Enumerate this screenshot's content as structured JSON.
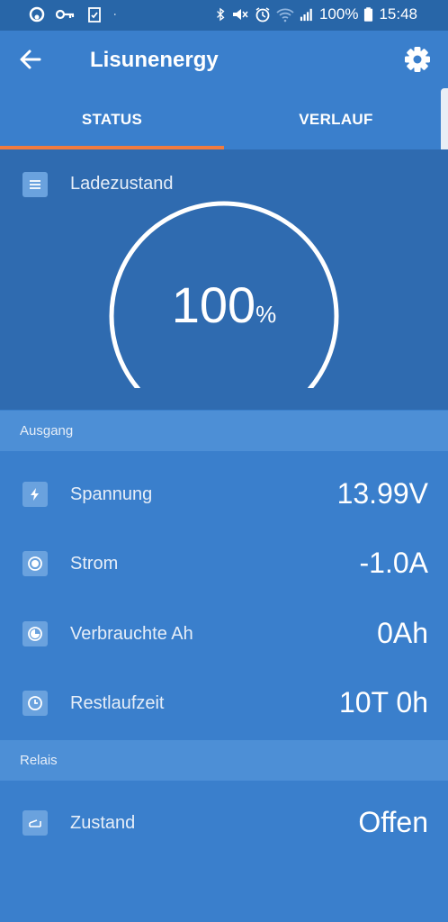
{
  "status_bar": {
    "battery": "100%",
    "time": "15:48",
    "icons": [
      "app-icon",
      "key-icon",
      "clipboard-check-icon",
      "dot-icon",
      "bluetooth-icon",
      "mute-icon",
      "alarm-icon",
      "wifi-icon",
      "signal-icon",
      "battery-icon"
    ]
  },
  "app_bar": {
    "title": "Lisunenergy",
    "back_icon": "arrow-back-icon",
    "settings_icon": "gear-icon"
  },
  "tabs": [
    {
      "label": "STATUS",
      "active": true
    },
    {
      "label": "VERLAUF",
      "active": false
    }
  ],
  "colors": {
    "accent": "#f07b3f",
    "primary": "#3a7fcc",
    "dark_card": "#2f6bb0",
    "section": "#4d8fd6"
  },
  "gauge": {
    "label": "Ladezustand",
    "value": "100",
    "unit": "%",
    "fraction": 1.0,
    "icon": "battery-list-icon"
  },
  "sections": {
    "output": {
      "title": "Ausgang",
      "rows": [
        {
          "label": "Spannung",
          "value": "13.99V",
          "icon": "bolt-icon"
        },
        {
          "label": "Strom",
          "value": "-1.0A",
          "icon": "circle-dot-icon"
        },
        {
          "label": "Verbrauchte Ah",
          "value": "0Ah",
          "icon": "consumed-icon"
        },
        {
          "label": "Restlaufzeit",
          "value": "10T 0h",
          "icon": "clock-icon"
        }
      ]
    },
    "relay": {
      "title": "Relais",
      "rows": [
        {
          "label": "Zustand",
          "value": "Offen",
          "icon": "relay-icon"
        }
      ]
    }
  }
}
